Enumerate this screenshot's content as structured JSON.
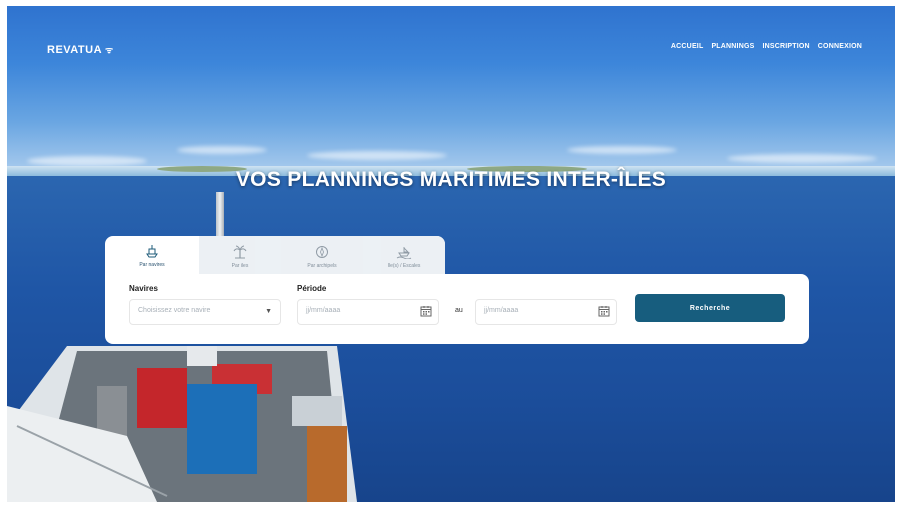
{
  "header": {
    "logo": "REVATUA",
    "nav": [
      {
        "label": "ACCUEIL"
      },
      {
        "label": "PLANNINGS"
      },
      {
        "label": "INSCRIPTION"
      },
      {
        "label": "CONNEXION"
      }
    ]
  },
  "hero": {
    "title": "VOS PLANNINGS MARITIMES INTER-ÎLES"
  },
  "search": {
    "tabs": [
      {
        "label": "Par navires",
        "icon": "ship-icon"
      },
      {
        "label": "Par iles",
        "icon": "palm-tree-icon"
      },
      {
        "label": "Par archipels",
        "icon": "compass-icon"
      },
      {
        "label": "Ile(s) / Escales",
        "icon": "boat-wave-icon"
      }
    ],
    "navires_label": "Navires",
    "navires_placeholder": "Choisissez votre navire",
    "periode_label": "Période",
    "date_from_placeholder": "jj/mm/aaaa",
    "au_label": "au",
    "date_to_placeholder": "jj/mm/aaaa",
    "submit_label": "Recherche"
  },
  "colors": {
    "primary": "#175d7e",
    "sky": "#3d86da",
    "sea": "#1f56a6"
  }
}
